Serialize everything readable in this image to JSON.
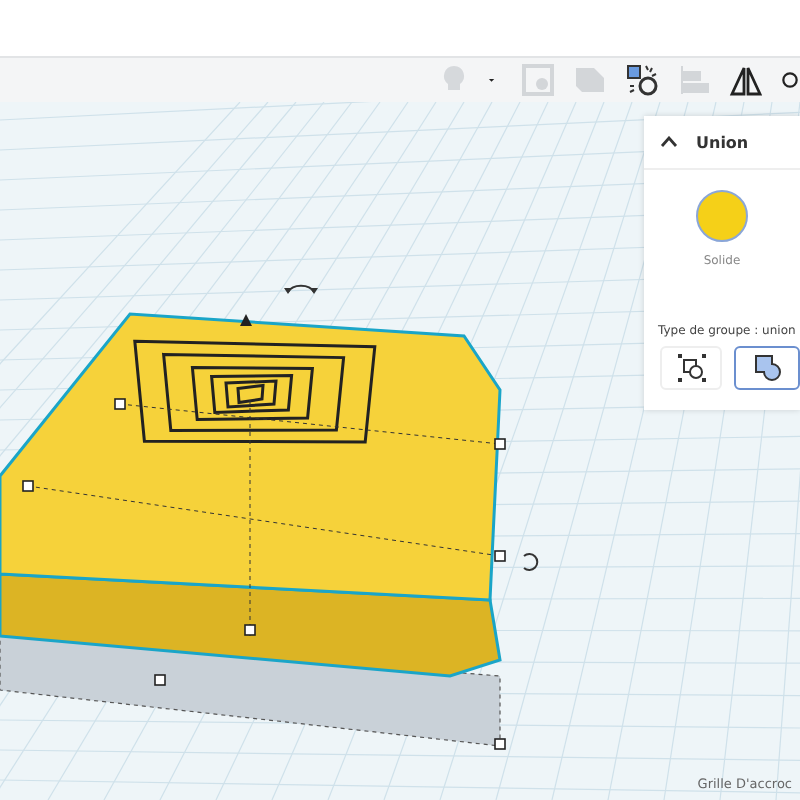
{
  "inspector": {
    "title": "Union",
    "expanded": true,
    "fill": {
      "color": "#f5d018",
      "label": "Solide"
    },
    "group_type_label": "Type de groupe : union",
    "group_types": [
      {
        "kind": "merge-shapes",
        "selected": false
      },
      {
        "kind": "union-shapes",
        "selected": true
      }
    ]
  },
  "workplane": {
    "snap_grid_label": "Grille D'accroc"
  }
}
